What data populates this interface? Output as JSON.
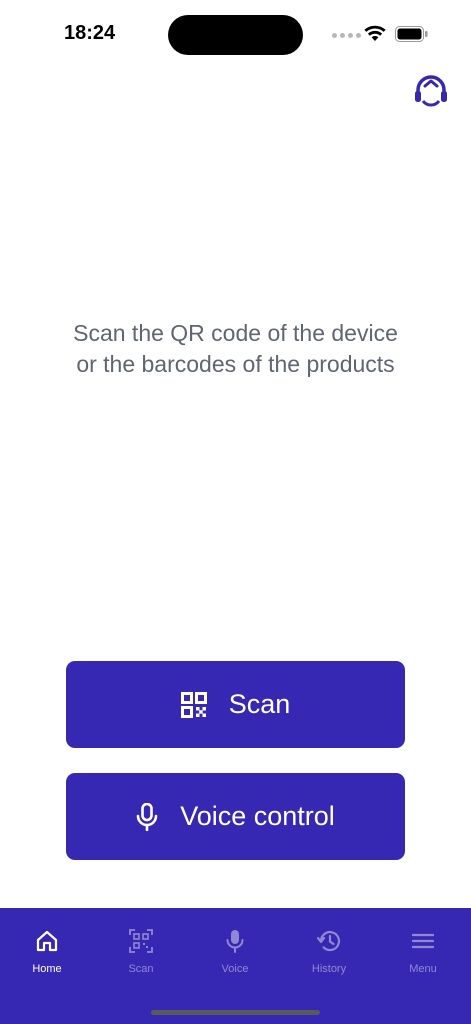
{
  "status_bar": {
    "time": "18:24"
  },
  "header": {
    "support_icon": "headset-icon"
  },
  "main": {
    "instructions": "Scan the QR code of the device or the barcodes of the products",
    "scan_button": {
      "label": "Scan",
      "icon": "qr-code-icon"
    },
    "voice_button": {
      "label": "Voice control",
      "icon": "microphone-icon"
    }
  },
  "tabbar": {
    "active": "Home",
    "tabs": [
      {
        "label": "Home",
        "icon": "home-icon"
      },
      {
        "label": "Scan",
        "icon": "qr-scan-icon"
      },
      {
        "label": "Voice",
        "icon": "microphone-icon"
      },
      {
        "label": "History",
        "icon": "history-icon"
      },
      {
        "label": "Menu",
        "icon": "hamburger-menu-icon"
      }
    ]
  },
  "colors": {
    "primary": "#3628b3",
    "text_muted": "#5f6670",
    "tab_inactive": "#8f88d4"
  }
}
